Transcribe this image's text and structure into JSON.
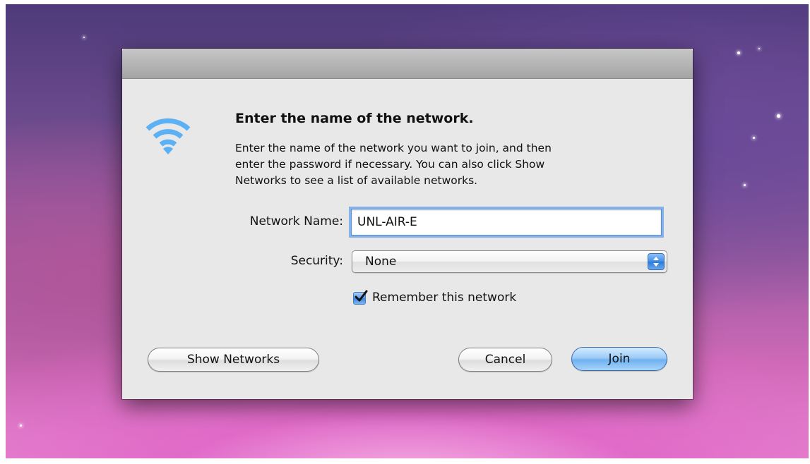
{
  "dialog": {
    "icon": "wifi-icon",
    "heading": "Enter the name of the network.",
    "description_lines": [
      "Enter the name of the network you want to join, and then",
      "enter the password if necessary. You can also click Show",
      "Networks to see a list of available networks."
    ],
    "network_name": {
      "label": "Network Name:",
      "value": "UNL-AIR-E"
    },
    "security": {
      "label": "Security:",
      "selected": "None"
    },
    "remember": {
      "label": "Remember this network",
      "checked": true
    },
    "buttons": {
      "show_networks": "Show Networks",
      "cancel": "Cancel",
      "join": "Join"
    }
  },
  "colors": {
    "accent": "#6fb1f0",
    "wifi": "#4aa3f0"
  }
}
